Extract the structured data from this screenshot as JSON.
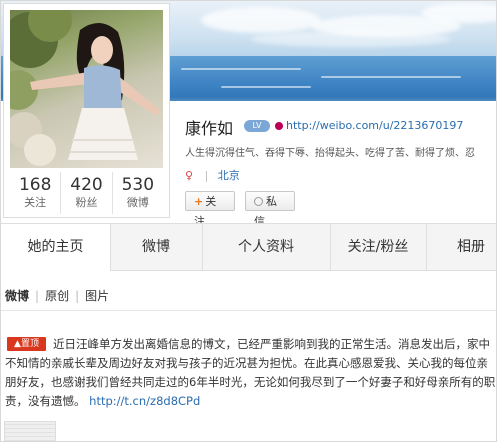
{
  "profile": {
    "name": "康作如",
    "verified_badge": "LV",
    "url": "http://weibo.com/u/2213670197",
    "motto": "人生得沉得住气、吞得下辱、抬得起头、吃得了苦、耐得了烦、忍",
    "location_prefix": "|",
    "location": "北京",
    "follow_label": "关注",
    "follow_plus": "+",
    "message_label": "私信"
  },
  "stats": [
    {
      "value": "168",
      "label": "关注"
    },
    {
      "value": "420",
      "label": "粉丝"
    },
    {
      "value": "530",
      "label": "微博"
    }
  ],
  "tabs": [
    {
      "label": "她的主页"
    },
    {
      "label": "微博"
    },
    {
      "label": "个人资料"
    },
    {
      "label": "关注/粉丝"
    },
    {
      "label": "相册"
    }
  ],
  "subtabs": {
    "weibo": "微博",
    "original": "原创",
    "photos": "图片",
    "divider": "|"
  },
  "post": {
    "pin_label": "置顶",
    "text": "近日汪峰单方发出离婚信息的博文，已经严重影响到我的正常生活。消息发出后，家中不知情的亲戚长辈及周边好友对我与孩子的近况甚为担忧。在此真心感恩爱我、关心我的每位亲朋好友，也感谢我们曾经共同走过的6年半时光，无论如何我尽到了一个好妻子和好母亲所有的职责，没有遗憾。",
    "link": "http://t.cn/z8d8CPd"
  },
  "colors": {
    "link": "#2a6db0",
    "pin": "#d9381e",
    "follow_plus": "#e8771b"
  }
}
